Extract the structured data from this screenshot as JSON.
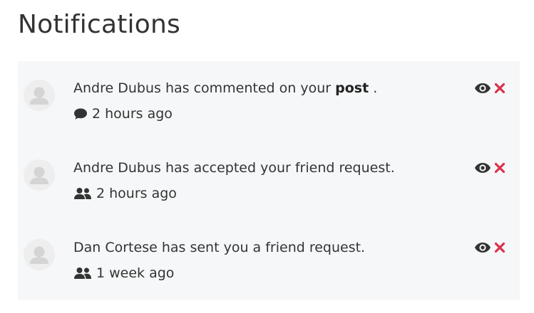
{
  "page": {
    "title": "Notifications"
  },
  "colors": {
    "panel_bg": "#f6f7f8",
    "text": "#333333",
    "dismiss_red": "#d9334a",
    "icon_dark": "#333333"
  },
  "notifications": [
    {
      "actor": "Andre Dubus",
      "action_text": "has commented on your",
      "object_text": "post",
      "tail_text": ".",
      "time_icon": "comment-icon",
      "time": "2 hours ago"
    },
    {
      "actor": "Andre Dubus",
      "action_text": "has accepted your friend request.",
      "object_text": "",
      "tail_text": "",
      "time_icon": "users-icon",
      "time": "2 hours ago"
    },
    {
      "actor": "Dan Cortese",
      "action_text": "has sent you a friend request.",
      "object_text": "",
      "tail_text": "",
      "time_icon": "users-icon",
      "time": "1 week ago"
    }
  ]
}
